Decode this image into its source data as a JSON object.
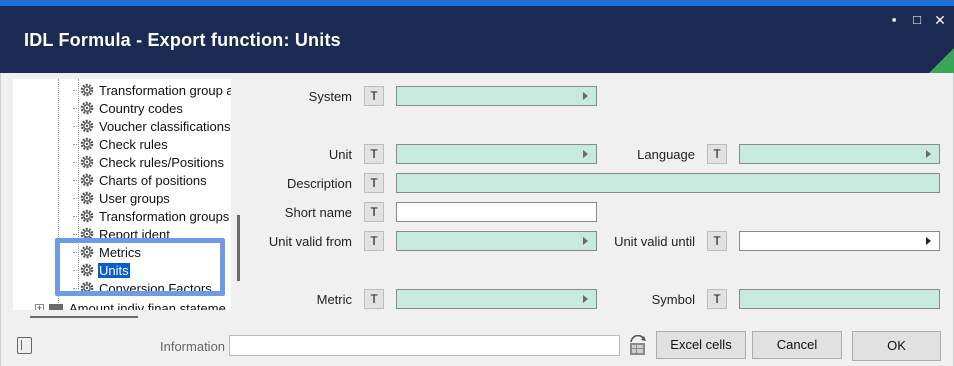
{
  "window": {
    "title": "IDL Formula - Export function: Units",
    "minimize": "▪",
    "maximize": "□",
    "close": "✕"
  },
  "tree": {
    "items": [
      {
        "label": "Transformation group al",
        "selected": false
      },
      {
        "label": "Country codes",
        "selected": false
      },
      {
        "label": "Voucher classifications",
        "selected": false
      },
      {
        "label": "Check rules",
        "selected": false
      },
      {
        "label": "Check rules/Positions",
        "selected": false
      },
      {
        "label": "Charts of positions",
        "selected": false
      },
      {
        "label": "User groups",
        "selected": false
      },
      {
        "label": "Transformation groups",
        "selected": false
      },
      {
        "label": "Report ident",
        "selected": false
      },
      {
        "label": "Metrics",
        "selected": false
      },
      {
        "label": "Units",
        "selected": true
      },
      {
        "label": "Conversion Factors",
        "selected": false
      }
    ],
    "root_item": {
      "label": "Amount indiv finan stateme",
      "expand_symbol": "+"
    }
  },
  "form": {
    "t_label": "T",
    "system": {
      "label": "System",
      "value": ""
    },
    "unit": {
      "label": "Unit",
      "value": ""
    },
    "language": {
      "label": "Language",
      "value": ""
    },
    "description": {
      "label": "Description",
      "value": ""
    },
    "short_name": {
      "label": "Short name",
      "value": ""
    },
    "unit_valid_from": {
      "label": "Unit valid from",
      "value": ""
    },
    "unit_valid_until": {
      "label": "Unit valid until",
      "value": ""
    },
    "metric": {
      "label": "Metric",
      "value": ""
    },
    "symbol": {
      "label": "Symbol",
      "value": ""
    }
  },
  "footer": {
    "information_label": "Information",
    "information_value": "",
    "excel_cells_label": "Excel cells",
    "cancel_label": "Cancel",
    "ok_label": "OK"
  },
  "colors": {
    "titlebar": "#1a2a52",
    "accent_strip": "#1e6fd9",
    "corner_accent": "#3aa655",
    "field_teal": "#c7eadf",
    "selection": "#0a5ec7",
    "highlight": "#6f9ae8"
  }
}
